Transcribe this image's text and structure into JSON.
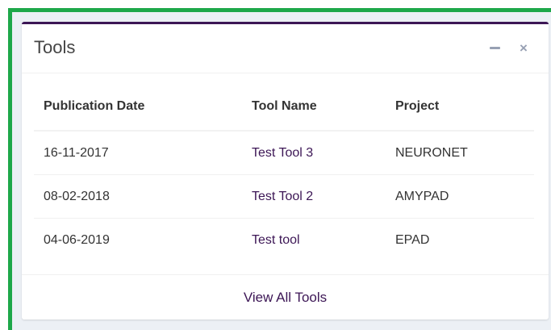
{
  "box": {
    "title": "Tools",
    "footer_link": "View All Tools"
  },
  "table": {
    "headers": [
      "Publication Date",
      "Tool Name",
      "Project"
    ],
    "rows": [
      {
        "date": "16-11-2017",
        "tool": "Test Tool 3",
        "project": "NEURONET"
      },
      {
        "date": "08-02-2018",
        "tool": "Test Tool 2",
        "project": "AMYPAD"
      },
      {
        "date": "04-06-2019",
        "tool": "Test tool",
        "project": "EPAD"
      }
    ]
  },
  "icons": {
    "minimize": "minus-icon",
    "close": "close-icon"
  },
  "colors": {
    "accent": "#3c1655",
    "frame_border": "#1ea84a",
    "tool_icons": "#97a0b3"
  }
}
